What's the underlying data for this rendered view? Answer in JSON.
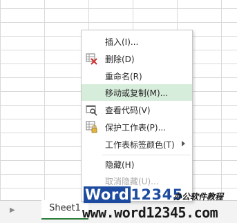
{
  "menu": {
    "items": [
      {
        "label": "插入(I)...",
        "icon": "",
        "enabled": true
      },
      {
        "label": "删除(D)",
        "icon": "delete-sheet-icon",
        "enabled": true
      },
      {
        "label": "重命名(R)",
        "icon": "",
        "enabled": true
      },
      {
        "label": "移动或复制(M)...",
        "icon": "",
        "enabled": true,
        "highlighted": true
      },
      {
        "label": "查看代码(V)",
        "icon": "view-code-icon",
        "enabled": true
      },
      {
        "label": "保护工作表(P)...",
        "icon": "protect-sheet-icon",
        "enabled": true
      },
      {
        "label": "工作表标签颜色(T)",
        "icon": "",
        "enabled": true,
        "submenu": true
      },
      {
        "label": "隐藏(H)",
        "icon": "",
        "enabled": true
      },
      {
        "label": "取消隐藏(U)...",
        "icon": "",
        "enabled": false
      }
    ]
  },
  "sheets": {
    "active_tab": "Sheet1"
  },
  "watermark": {
    "logo_word": "Word",
    "logo_digits": "12345",
    "tagline": "办公软件教程",
    "url": "www.word12345.com"
  },
  "colors": {
    "highlight": "#d7eddb",
    "active_tab_underline": "#2a7d3a",
    "delete_icon_red": "#d03030",
    "logo_blue": "#1d4ba0"
  }
}
